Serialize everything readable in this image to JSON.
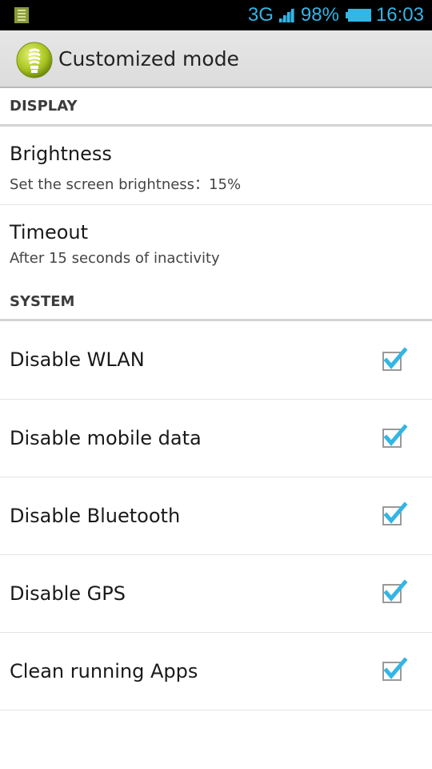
{
  "status_bar": {
    "network": "3G",
    "battery_percent": "98%",
    "time": "16:03",
    "left_icon": "sd-card-icon",
    "signal_icon": "signal-bars-icon",
    "battery_icon": "battery-icon",
    "accent_color": "#33b5e5"
  },
  "action_bar": {
    "title": "Customized mode",
    "icon": "power-saving-bulb-icon"
  },
  "sections": {
    "display": {
      "header": "DISPLAY",
      "items": [
        {
          "title": "Brightness",
          "summary": "Set the screen brightness：15%"
        },
        {
          "title": "Timeout",
          "summary": "After 15 seconds of inactivity"
        }
      ]
    },
    "system": {
      "header": "SYSTEM",
      "items": [
        {
          "title": "Disable WLAN",
          "checked": true
        },
        {
          "title": "Disable mobile data",
          "checked": true
        },
        {
          "title": "Disable Bluetooth",
          "checked": true
        },
        {
          "title": "Disable GPS",
          "checked": true
        },
        {
          "title": "Clean running Apps",
          "checked": true
        }
      ]
    }
  }
}
